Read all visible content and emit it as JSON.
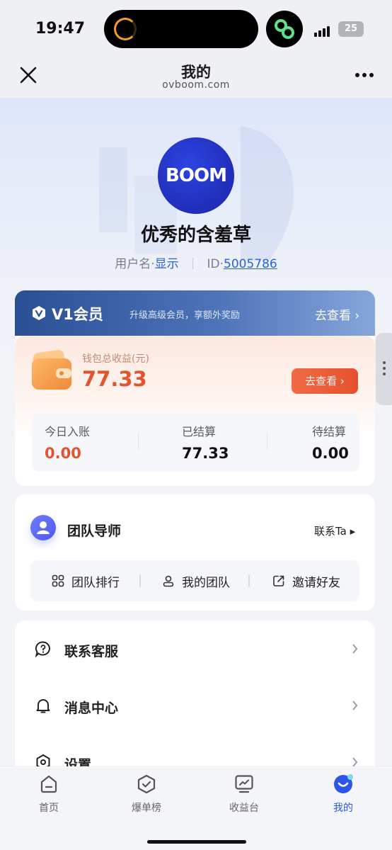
{
  "status_bar": {
    "time": "19:47",
    "battery": "25"
  },
  "nav": {
    "title": "我的",
    "subtitle": "ovboom.com"
  },
  "profile": {
    "avatar_text": "BOOM",
    "name": "优秀的含羞草",
    "username_label": "用户名·",
    "username_value": "显示",
    "id_label": "ID·",
    "id_value": "5005786"
  },
  "vip": {
    "title": "V1会员",
    "description": "升级高级会员，享额外奖励",
    "link": "去查看 ›"
  },
  "wallet": {
    "label": "钱包总收益(元)",
    "amount": "77.33",
    "button": "去查看 ›",
    "stats": [
      {
        "label": "今日入账",
        "value": "0.00"
      },
      {
        "label": "已结算",
        "value": "77.33"
      },
      {
        "label": "待结算",
        "value": "0.00"
      }
    ]
  },
  "team": {
    "title": "团队导师",
    "contact": "联系Ta ▸",
    "actions": [
      {
        "label": "团队排行",
        "icon": "grid-icon"
      },
      {
        "label": "我的团队",
        "icon": "person-icon"
      },
      {
        "label": "邀请好友",
        "icon": "share-icon"
      }
    ]
  },
  "menu": {
    "items": [
      {
        "label": "联系客服",
        "icon": "chat-help-icon"
      },
      {
        "label": "消息中心",
        "icon": "bell-icon"
      },
      {
        "label": "设置",
        "icon": "settings-icon"
      }
    ]
  },
  "tabs": [
    {
      "label": "首页",
      "icon": "home-icon"
    },
    {
      "label": "爆单榜",
      "icon": "shield-check-icon"
    },
    {
      "label": "收益台",
      "icon": "chart-icon"
    },
    {
      "label": "我的",
      "icon": "smile-icon",
      "active": true
    }
  ],
  "colors": {
    "accent": "#2f55e8",
    "money_red": "#e2542e",
    "vip_blue": "#2a4f95"
  }
}
